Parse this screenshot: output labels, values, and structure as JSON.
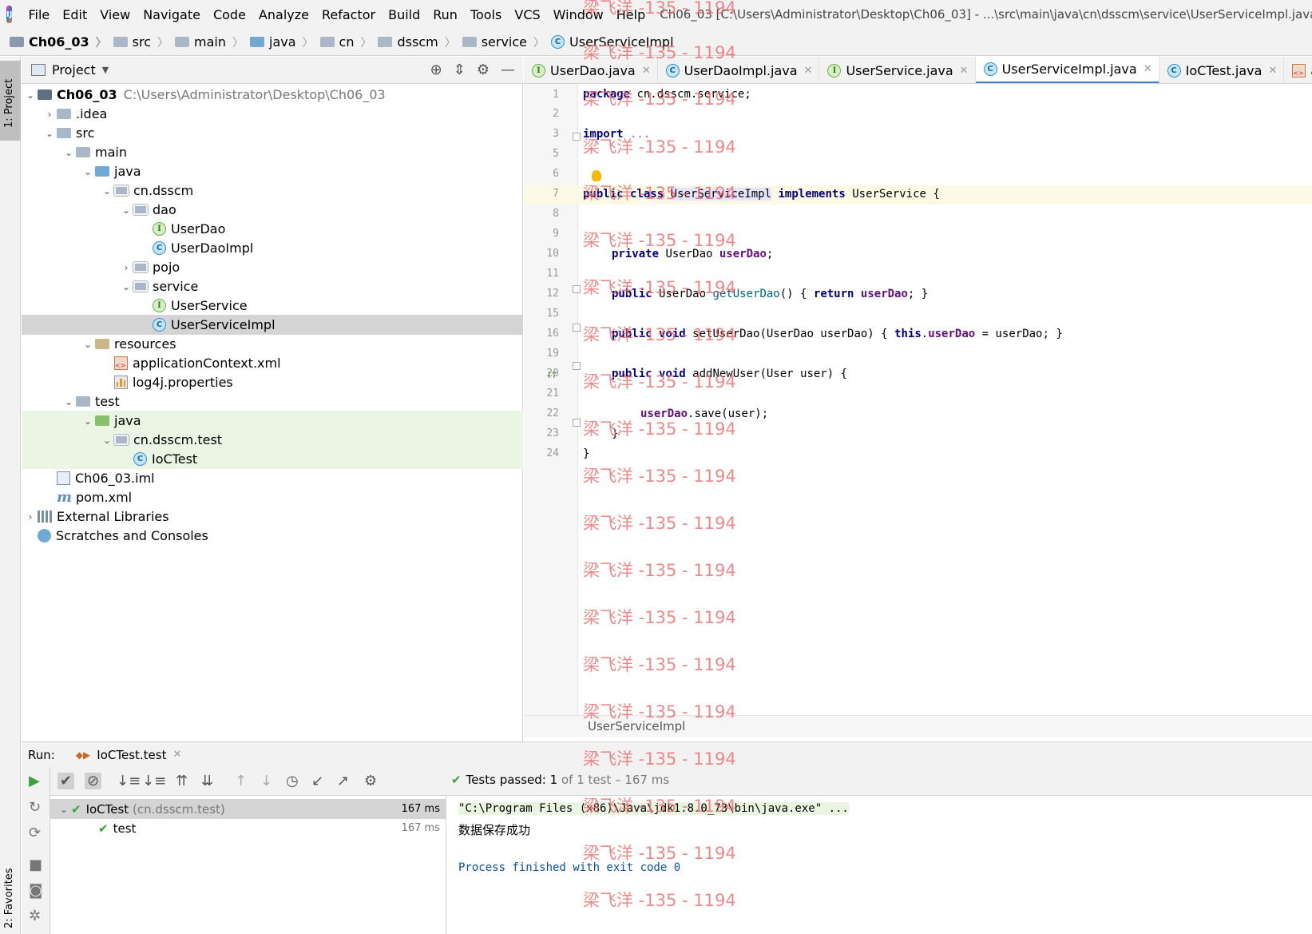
{
  "menu": {
    "items": [
      "File",
      "Edit",
      "View",
      "Navigate",
      "Code",
      "Analyze",
      "Refactor",
      "Build",
      "Run",
      "Tools",
      "VCS",
      "Window",
      "Help"
    ],
    "window_title": "Ch06_03 [C:\\Users\\Administrator\\Desktop\\Ch06_03] - ...\\src\\main\\java\\cn\\dsscm\\service\\UserServiceImpl.java - IntelliJ"
  },
  "breadcrumb": [
    "Ch06_03",
    "src",
    "main",
    "java",
    "cn",
    "dsscm",
    "service",
    "UserServiceImpl"
  ],
  "side_tabs": {
    "project": "1: Project",
    "favorites": "2: Favorites"
  },
  "project_panel": {
    "title": "Project",
    "tree": [
      {
        "label": "Ch06_03",
        "extra": "C:\\Users\\Administrator\\Desktop\\Ch06_03"
      },
      {
        "label": ".idea"
      },
      {
        "label": "src"
      },
      {
        "label": "main"
      },
      {
        "label": "java"
      },
      {
        "label": "cn.dsscm"
      },
      {
        "label": "dao"
      },
      {
        "label": "UserDao"
      },
      {
        "label": "UserDaoImpl"
      },
      {
        "label": "pojo"
      },
      {
        "label": "service"
      },
      {
        "label": "UserService"
      },
      {
        "label": "UserServiceImpl"
      },
      {
        "label": "resources"
      },
      {
        "label": "applicationContext.xml"
      },
      {
        "label": "log4j.properties"
      },
      {
        "label": "test"
      },
      {
        "label": "java"
      },
      {
        "label": "cn.dsscm.test"
      },
      {
        "label": "IoCTest"
      },
      {
        "label": "Ch06_03.iml"
      },
      {
        "label": "pom.xml"
      },
      {
        "label": "External Libraries"
      },
      {
        "label": "Scratches and Consoles"
      }
    ]
  },
  "editor_tabs": [
    "UserDao.java",
    "UserDaoImpl.java",
    "UserService.java",
    "UserServiceImpl.java",
    "IoCTest.java",
    "application"
  ],
  "editor": {
    "line_numbers": [
      "1",
      "2",
      "3",
      "5",
      "6",
      "7",
      "8",
      "9",
      "10",
      "11",
      "12",
      "15",
      "16",
      "19",
      "20",
      "21",
      "22",
      "23",
      "24"
    ],
    "code": {
      "l1_kw": "package",
      "l1_rest": " cn.dsscm.service;",
      "l3_kw": "import",
      "l3_rest": " ...",
      "l7_kw1": "public",
      "l7_kw2": "class",
      "l7_name": "UserServiceImpl",
      "l7_kw3": "implements",
      "l7_rest": " UserService {",
      "l10_kw": "private",
      "l10_type": " UserDao ",
      "l10_field": "userDao",
      "l10_end": ";",
      "l12_kw": "public",
      "l12_type": " UserDao ",
      "l12_method": "getUserDao",
      "l12_mid": "() { ",
      "l12_ret": "return",
      "l12_sp": " ",
      "l12_field": "userDao",
      "l12_end": "; }",
      "l16_kw1": "public",
      "l16_kw2": "void",
      "l16_sig": " setUserDao(UserDao userDao) { ",
      "l16_this": "this",
      "l16_dot": ".",
      "l16_field": "userDao",
      "l16_end": " = userDao; }",
      "l20_kw1": "public",
      "l20_kw2": "void",
      "l20_sig": " addNewUser(User user) {",
      "l22_field": "userDao",
      "l22_end": ".save(user);",
      "l23": "}",
      "l24": "}"
    },
    "footer": "UserServiceImpl"
  },
  "run_panel": {
    "label": "Run:",
    "tab": "IoCTest.test",
    "status_prefix": "Tests passed:",
    "status_count": "1",
    "status_suffix": "of 1 test – 167 ms",
    "tree": [
      {
        "name": "IoCTest",
        "pkg": "(cn.dsscm.test)",
        "time": "167 ms"
      },
      {
        "name": "test",
        "time": "167 ms"
      }
    ],
    "console": [
      "\"C:\\Program Files (x86)\\Java\\jdk1.8.0_73\\bin\\java.exe\" ...",
      "数据保存成功",
      "Process finished with exit code 0"
    ]
  },
  "watermark": "梁飞洋 -135 - 1194",
  "colors": {
    "accent": "#4083c9",
    "keyword": "#000080",
    "field": "#660e7a",
    "passed": "#3aa23a",
    "watermark": "#ec6b6b"
  }
}
